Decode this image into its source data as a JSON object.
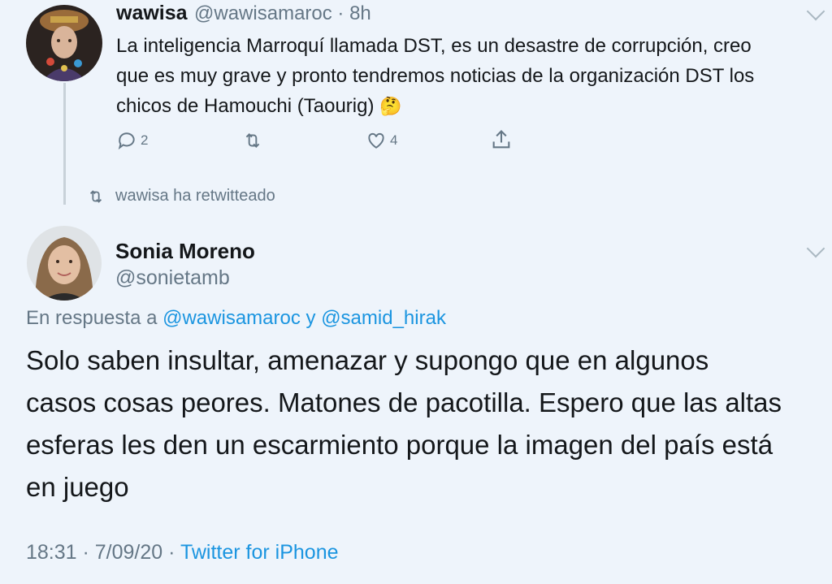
{
  "tweet1": {
    "name": "wawisa",
    "handle_time": "@wawisamaroc · 8h",
    "text_lines": [
      "La inteligencia Marroquí llamada DST, es un desastre de corrupción, creo",
      "que es muy grave y pronto tendremos noticias de la organización DST los",
      "chicos de Hamouchi (Taourig)"
    ],
    "emoji": "🤔",
    "reply_count": "2",
    "like_count": "4"
  },
  "retweet_label": "wawisa ha retwitteado",
  "tweet2": {
    "name": "Sonia Moreno",
    "handle": "@sonietamb",
    "reply_prefix": "En respuesta a",
    "reply_user1": "@wawisamaroc",
    "reply_and": "y",
    "reply_user2": "@samid_hirak",
    "text_lines": [
      "Solo saben insultar, amenazar y supongo que en algunos",
      "casos cosas peores. Matones de pacotilla. Espero que las altas",
      "esferas les den un escarmiento porque la imagen del país está",
      "en juego"
    ],
    "time_date": "18:31 · 7/09/20 ·",
    "source": "Twitter for iPhone"
  },
  "icons": [
    "reply-icon",
    "retweet-icon",
    "like-icon",
    "share-icon",
    "chevron-down-icon"
  ],
  "colors": {
    "background": "#eef4fb",
    "link": "#1b95e0",
    "muted": "#657786"
  }
}
